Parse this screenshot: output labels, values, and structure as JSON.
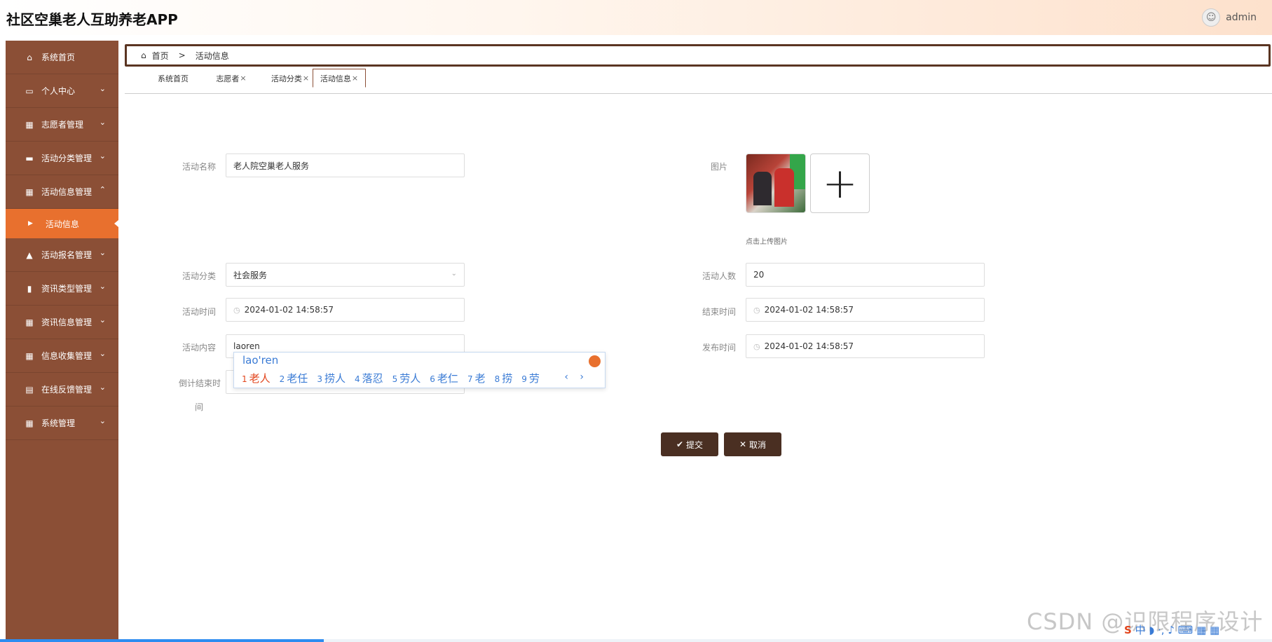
{
  "app": {
    "title": "社区空巢老人互助养老APP",
    "user": "admin"
  },
  "sidebar": {
    "items": [
      {
        "label": "系统首页",
        "icon": "home-icon"
      },
      {
        "label": "个人中心",
        "icon": "calendar-icon"
      },
      {
        "label": "志愿者管理",
        "icon": "grid-icon"
      },
      {
        "label": "活动分类管理",
        "icon": "monitor-icon"
      },
      {
        "label": "活动信息管理",
        "icon": "grid-icon",
        "expanded": true
      },
      {
        "label": "活动报名管理",
        "icon": "thumb-icon"
      },
      {
        "label": "资讯类型管理",
        "icon": "bar-chart-icon"
      },
      {
        "label": "资讯信息管理",
        "icon": "grid-icon"
      },
      {
        "label": "信息收集管理",
        "icon": "grid-icon"
      },
      {
        "label": "在线反馈管理",
        "icon": "clipboard-icon"
      },
      {
        "label": "系统管理",
        "icon": "grid-icon"
      }
    ],
    "sub_active": "活动信息"
  },
  "breadcrumb": {
    "home": "首页",
    "sep": ">",
    "current": "活动信息"
  },
  "tabs": [
    {
      "label": "系统首页",
      "closable": false
    },
    {
      "label": "志愿者",
      "closable": true
    },
    {
      "label": "活动分类",
      "closable": true
    },
    {
      "label": "活动信息",
      "closable": true,
      "active": true
    }
  ],
  "form": {
    "name_label": "活动名称",
    "name_value": "老人院空巢老人服务",
    "image_label": "图片",
    "upload_hint": "点击上传图片",
    "category_label": "活动分类",
    "category_value": "社会服务",
    "count_label": "活动人数",
    "count_value": "20",
    "start_label": "活动时间",
    "start_value": "2024-01-02 14:58:57",
    "end_label": "结束时间",
    "end_value": "2024-01-02 14:58:57",
    "content_label": "活动内容",
    "content_value": "laoren",
    "publish_label": "发布时间",
    "publish_value": "2024-01-02 14:58:57",
    "countdown_label_1": "倒计结束时",
    "countdown_label_2": "间"
  },
  "ime": {
    "pinyin": "lao'ren",
    "candidates": [
      {
        "n": "1",
        "text": "老人"
      },
      {
        "n": "2",
        "text": "老任"
      },
      {
        "n": "3",
        "text": "捞人"
      },
      {
        "n": "4",
        "text": "落忍"
      },
      {
        "n": "5",
        "text": "劳人"
      },
      {
        "n": "6",
        "text": "老仁"
      },
      {
        "n": "7",
        "text": "老"
      },
      {
        "n": "8",
        "text": "捞"
      },
      {
        "n": "9",
        "text": "劳"
      }
    ],
    "pager": "‹ ›"
  },
  "buttons": {
    "submit": "提交",
    "cancel": "取消"
  },
  "watermark": "CSDN @识限程序设计",
  "tray": {
    "logo": "S",
    "items": "中 ◗ ·, ♪ ⌨ ▦ ▦"
  },
  "colors": {
    "sidebar": "#8b4f36",
    "active_sub": "#e8702e",
    "button": "#4a2f22",
    "breadcrumb_border": "#5a3522"
  }
}
